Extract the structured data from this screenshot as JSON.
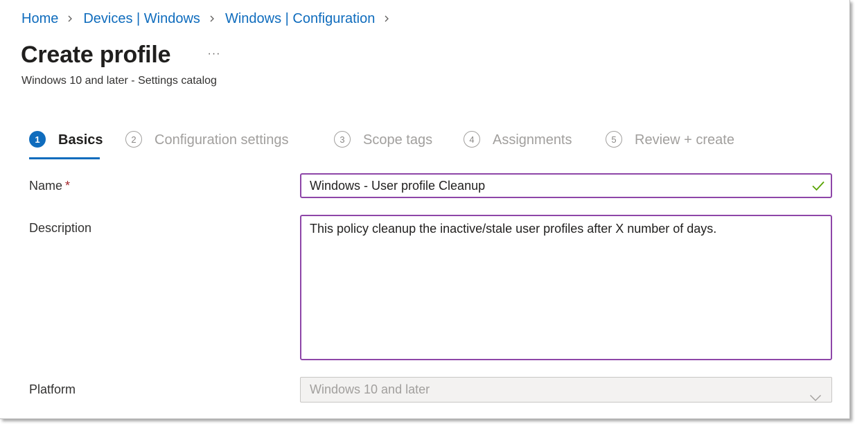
{
  "breadcrumb": {
    "items": [
      "Home",
      "Devices | Windows",
      "Windows | Configuration"
    ]
  },
  "header": {
    "title": "Create profile",
    "more_label": "···",
    "subtitle": "Windows 10 and later - Settings catalog"
  },
  "steps": [
    {
      "number": "1",
      "label": "Basics",
      "active": true
    },
    {
      "number": "2",
      "label": "Configuration settings",
      "active": false
    },
    {
      "number": "3",
      "label": "Scope tags",
      "active": false
    },
    {
      "number": "4",
      "label": "Assignments",
      "active": false
    },
    {
      "number": "5",
      "label": "Review + create",
      "active": false
    }
  ],
  "form": {
    "name": {
      "label": "Name",
      "required_mark": "*",
      "value": "Windows - User profile Cleanup",
      "valid_icon": "checkmark-icon"
    },
    "description": {
      "label": "Description",
      "value": "This policy cleanup the inactive/stale user profiles after X number of days."
    },
    "platform": {
      "label": "Platform",
      "value": "Windows 10 and later",
      "icon": "chevron-down-icon"
    }
  },
  "colors": {
    "accent": "#0f6cbd",
    "input_border_focus": "#8e46a8",
    "valid_check": "#57a300",
    "required": "#a4262c"
  }
}
